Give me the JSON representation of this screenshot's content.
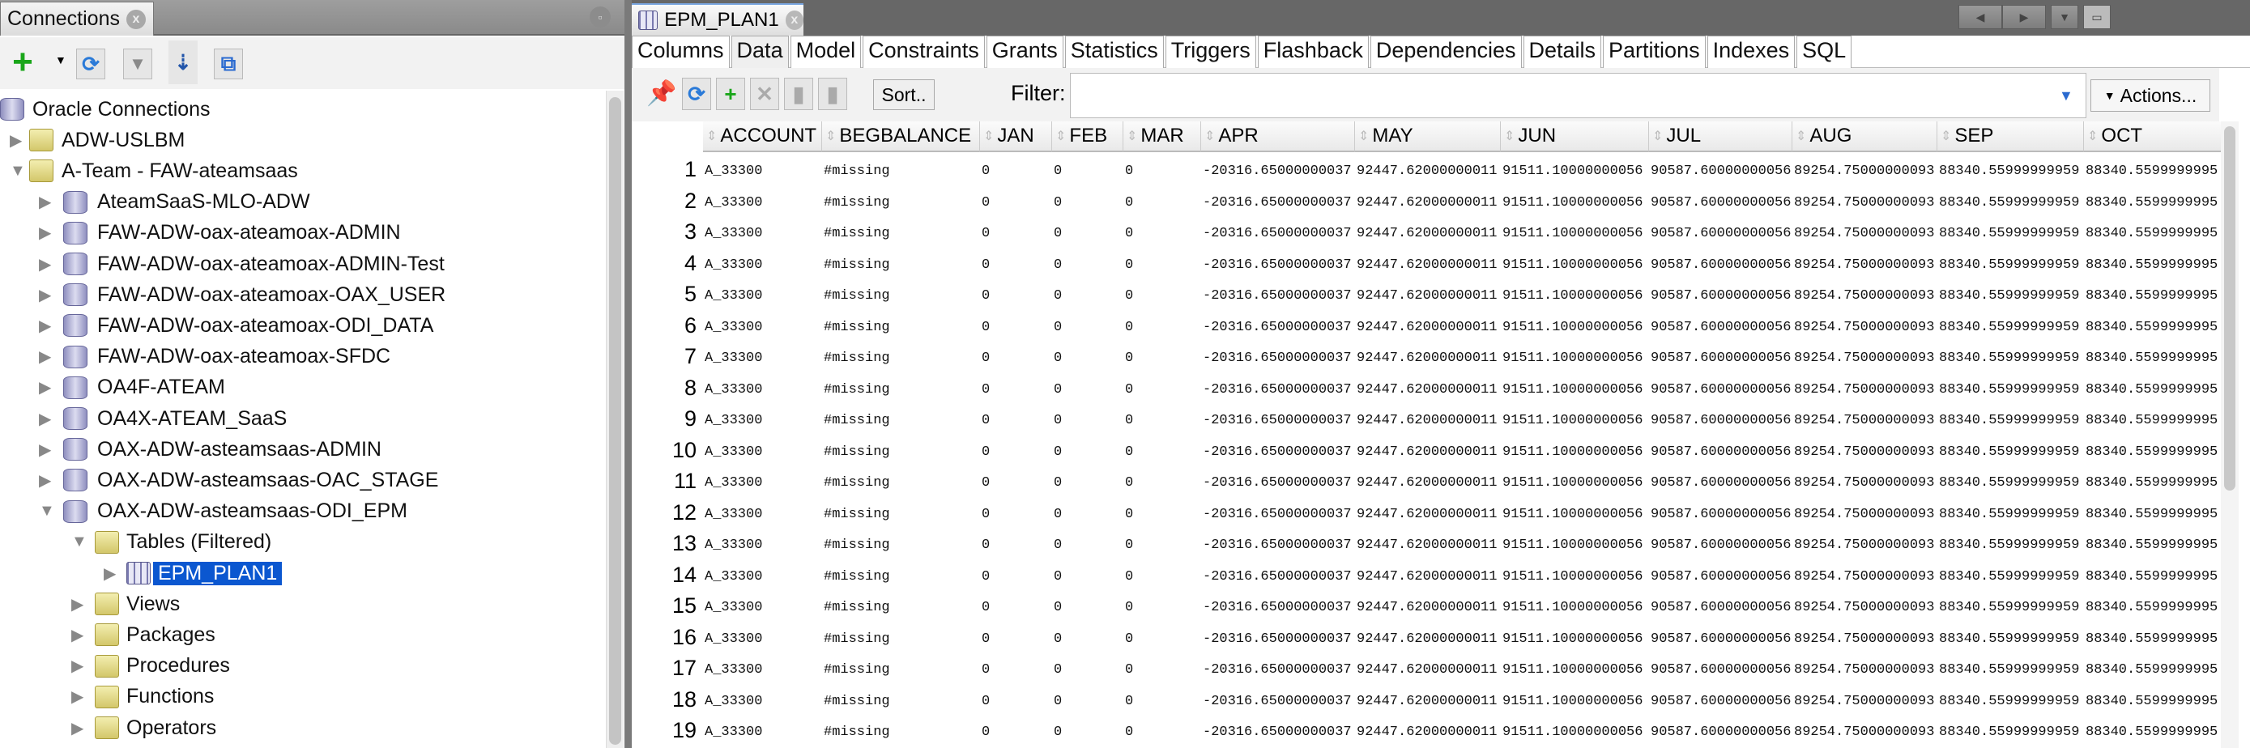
{
  "connections_panel": {
    "tab_title": "Connections",
    "close": "x",
    "minimize": "▫",
    "toolbar": [
      {
        "name": "add-connection",
        "glyph": "+"
      },
      {
        "name": "refresh",
        "glyph": "⟳"
      },
      {
        "name": "filter",
        "glyph": "▼"
      },
      {
        "name": "schema-browser",
        "glyph": "⇣"
      },
      {
        "name": "collapse",
        "glyph": "⧉"
      }
    ],
    "tree": [
      {
        "label": "Oracle Connections",
        "level": 0,
        "icon": "database-icon",
        "expanded": null
      },
      {
        "label": "ADW-USLBM",
        "level": 1,
        "icon": "folder-icon",
        "expanded": false
      },
      {
        "label": "A-Team - FAW-ateamsaas",
        "level": 1,
        "icon": "folder-icon",
        "expanded": true
      },
      {
        "label": "AteamSaaS-MLO-ADW",
        "level": 2,
        "icon": "database-icon",
        "expanded": false
      },
      {
        "label": "FAW-ADW-oax-ateamoax-ADMIN",
        "level": 2,
        "icon": "database-icon",
        "expanded": false
      },
      {
        "label": "FAW-ADW-oax-ateamoax-ADMIN-Test",
        "level": 2,
        "icon": "database-icon",
        "expanded": false
      },
      {
        "label": "FAW-ADW-oax-ateamoax-OAX_USER",
        "level": 2,
        "icon": "database-icon",
        "expanded": false
      },
      {
        "label": "FAW-ADW-oax-ateamoax-ODI_DATA",
        "level": 2,
        "icon": "database-icon",
        "expanded": false
      },
      {
        "label": "FAW-ADW-oax-ateamoax-SFDC",
        "level": 2,
        "icon": "database-icon",
        "expanded": false
      },
      {
        "label": "OA4F-ATEAM",
        "level": 2,
        "icon": "database-icon",
        "expanded": false
      },
      {
        "label": "OA4X-ATEAM_SaaS",
        "level": 2,
        "icon": "database-icon",
        "expanded": false
      },
      {
        "label": "OAX-ADW-asteamsaas-ADMIN",
        "level": 2,
        "icon": "database-icon",
        "expanded": false
      },
      {
        "label": "OAX-ADW-asteamsaas-OAC_STAGE",
        "level": 2,
        "icon": "database-icon",
        "expanded": false
      },
      {
        "label": "OAX-ADW-asteamsaas-ODI_EPM",
        "level": 2,
        "icon": "database-icon",
        "expanded": true
      },
      {
        "label": "Tables (Filtered)",
        "level": 3,
        "icon": "folder-icon",
        "expanded": true
      },
      {
        "label": "EPM_PLAN1",
        "level": 4,
        "icon": "table-icon",
        "expanded": false,
        "selected": true
      },
      {
        "label": "Views",
        "level": 3,
        "icon": "folder-icon",
        "expanded": false
      },
      {
        "label": "Packages",
        "level": 3,
        "icon": "folder-icon",
        "expanded": false
      },
      {
        "label": "Procedures",
        "level": 3,
        "icon": "folder-icon",
        "expanded": false
      },
      {
        "label": "Functions",
        "level": 3,
        "icon": "folder-icon",
        "expanded": false
      },
      {
        "label": "Operators",
        "level": 3,
        "icon": "folder-icon",
        "expanded": false
      }
    ]
  },
  "editor": {
    "tab_title": "EPM_PLAN1",
    "subtabs": [
      "Columns",
      "Data",
      "Model",
      "Constraints",
      "Grants",
      "Statistics",
      "Triggers",
      "Flashback",
      "Dependencies",
      "Details",
      "Partitions",
      "Indexes",
      "SQL"
    ],
    "active_subtab": "Data",
    "sort_label": "Sort..",
    "filter_label": "Filter:",
    "filter_value": "",
    "actions_label": "Actions...",
    "columns": [
      "ACCOUNT",
      "BEGBALANCE",
      "JAN",
      "FEB",
      "MAR",
      "APR",
      "MAY",
      "JUN",
      "JUL",
      "AUG",
      "SEP",
      "OCT"
    ],
    "rows": [
      [
        1,
        "A_33300",
        "#missing",
        "0",
        "0",
        "0",
        "-20316.65000000037",
        "92447.62000000011",
        "91511.10000000056",
        "90587.60000000056",
        "89254.75000000093",
        "88340.55999999959",
        "88340.5599999995"
      ],
      [
        2,
        "A_33300",
        "#missing",
        "0",
        "0",
        "0",
        "-20316.65000000037",
        "92447.62000000011",
        "91511.10000000056",
        "90587.60000000056",
        "89254.75000000093",
        "88340.55999999959",
        "88340.5599999995"
      ],
      [
        3,
        "A_33300",
        "#missing",
        "0",
        "0",
        "0",
        "-20316.65000000037",
        "92447.62000000011",
        "91511.10000000056",
        "90587.60000000056",
        "89254.75000000093",
        "88340.55999999959",
        "88340.5599999995"
      ],
      [
        4,
        "A_33300",
        "#missing",
        "0",
        "0",
        "0",
        "-20316.65000000037",
        "92447.62000000011",
        "91511.10000000056",
        "90587.60000000056",
        "89254.75000000093",
        "88340.55999999959",
        "88340.5599999995"
      ],
      [
        5,
        "A_33300",
        "#missing",
        "0",
        "0",
        "0",
        "-20316.65000000037",
        "92447.62000000011",
        "91511.10000000056",
        "90587.60000000056",
        "89254.75000000093",
        "88340.55999999959",
        "88340.5599999995"
      ],
      [
        6,
        "A_33300",
        "#missing",
        "0",
        "0",
        "0",
        "-20316.65000000037",
        "92447.62000000011",
        "91511.10000000056",
        "90587.60000000056",
        "89254.75000000093",
        "88340.55999999959",
        "88340.5599999995"
      ],
      [
        7,
        "A_33300",
        "#missing",
        "0",
        "0",
        "0",
        "-20316.65000000037",
        "92447.62000000011",
        "91511.10000000056",
        "90587.60000000056",
        "89254.75000000093",
        "88340.55999999959",
        "88340.5599999995"
      ],
      [
        8,
        "A_33300",
        "#missing",
        "0",
        "0",
        "0",
        "-20316.65000000037",
        "92447.62000000011",
        "91511.10000000056",
        "90587.60000000056",
        "89254.75000000093",
        "88340.55999999959",
        "88340.5599999995"
      ],
      [
        9,
        "A_33300",
        "#missing",
        "0",
        "0",
        "0",
        "-20316.65000000037",
        "92447.62000000011",
        "91511.10000000056",
        "90587.60000000056",
        "89254.75000000093",
        "88340.55999999959",
        "88340.5599999995"
      ],
      [
        10,
        "A_33300",
        "#missing",
        "0",
        "0",
        "0",
        "-20316.65000000037",
        "92447.62000000011",
        "91511.10000000056",
        "90587.60000000056",
        "89254.75000000093",
        "88340.55999999959",
        "88340.5599999995"
      ],
      [
        11,
        "A_33300",
        "#missing",
        "0",
        "0",
        "0",
        "-20316.65000000037",
        "92447.62000000011",
        "91511.10000000056",
        "90587.60000000056",
        "89254.75000000093",
        "88340.55999999959",
        "88340.5599999995"
      ],
      [
        12,
        "A_33300",
        "#missing",
        "0",
        "0",
        "0",
        "-20316.65000000037",
        "92447.62000000011",
        "91511.10000000056",
        "90587.60000000056",
        "89254.75000000093",
        "88340.55999999959",
        "88340.5599999995"
      ],
      [
        13,
        "A_33300",
        "#missing",
        "0",
        "0",
        "0",
        "-20316.65000000037",
        "92447.62000000011",
        "91511.10000000056",
        "90587.60000000056",
        "89254.75000000093",
        "88340.55999999959",
        "88340.5599999995"
      ],
      [
        14,
        "A_33300",
        "#missing",
        "0",
        "0",
        "0",
        "-20316.65000000037",
        "92447.62000000011",
        "91511.10000000056",
        "90587.60000000056",
        "89254.75000000093",
        "88340.55999999959",
        "88340.5599999995"
      ],
      [
        15,
        "A_33300",
        "#missing",
        "0",
        "0",
        "0",
        "-20316.65000000037",
        "92447.62000000011",
        "91511.10000000056",
        "90587.60000000056",
        "89254.75000000093",
        "88340.55999999959",
        "88340.5599999995"
      ],
      [
        16,
        "A_33300",
        "#missing",
        "0",
        "0",
        "0",
        "-20316.65000000037",
        "92447.62000000011",
        "91511.10000000056",
        "90587.60000000056",
        "89254.75000000093",
        "88340.55999999959",
        "88340.5599999995"
      ],
      [
        17,
        "A_33300",
        "#missing",
        "0",
        "0",
        "0",
        "-20316.65000000037",
        "92447.62000000011",
        "91511.10000000056",
        "90587.60000000056",
        "89254.75000000093",
        "88340.55999999959",
        "88340.5599999995"
      ],
      [
        18,
        "A_33300",
        "#missing",
        "0",
        "0",
        "0",
        "-20316.65000000037",
        "92447.62000000011",
        "91511.10000000056",
        "90587.60000000056",
        "89254.75000000093",
        "88340.55999999959",
        "88340.5599999995"
      ],
      [
        19,
        "A_33300",
        "#missing",
        "0",
        "0",
        "0",
        "-20316.65000000037",
        "92447.62000000011",
        "91511.10000000056",
        "90587.60000000056",
        "89254.75000000093",
        "88340.55999999959",
        "88340.5599999995"
      ]
    ]
  },
  "colors": {
    "selection": "#0b57d0",
    "tabbar": "#676767"
  }
}
